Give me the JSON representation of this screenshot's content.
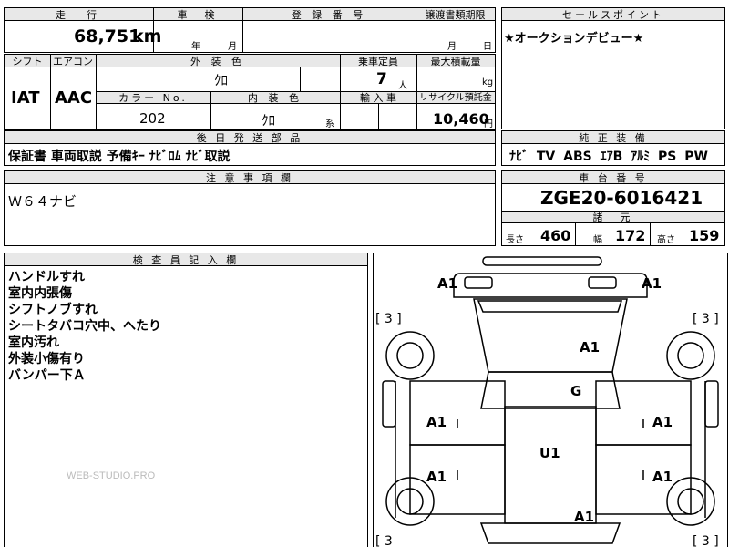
{
  "top_row": {
    "mileage_label": "走　行",
    "mileage_value": "68,751",
    "mileage_unit": "km",
    "inspection_label": "車　検",
    "inspection_year_unit": "年",
    "inspection_month_unit": "月",
    "registration_label": "登 録 番 号",
    "transfer_label": "譲渡書類期限",
    "transfer_month_unit": "月",
    "transfer_day_unit": "日"
  },
  "second_row": {
    "shift_label": "シフト",
    "shift_value": "IAT",
    "aircon_label": "エアコン",
    "aircon_value": "AAC",
    "exterior_color_label": "外 装 色",
    "exterior_color_value": "ｸﾛ",
    "capacity_label": "乗車定員",
    "capacity_value": "7",
    "capacity_unit": "人",
    "max_load_label": "最大積載量",
    "max_load_unit": "kg",
    "color_no_label": "カラー No.",
    "color_no_value": "202",
    "interior_color_label": "内 装 色",
    "interior_color_value": "ｸﾛ",
    "interior_color_unit": "系",
    "import_label": "輸 入 車",
    "recycle_label": "リサイクル預託金",
    "recycle_value": "10,460",
    "recycle_unit": "円"
  },
  "delivery_items": {
    "label": "後 日 発 送 部 品",
    "value": "保証書 車両取説 予備ｷｰ ﾅﾋﾞﾛﾑ ﾅﾋﾞ取説"
  },
  "sales_point": {
    "label": "セールスポイント",
    "value": "★オークションデビュー★"
  },
  "standard_equipment": {
    "label": "純 正 装 備",
    "value": "ﾅﾋﾞ TV ABS ｴｱB ｱﾙﾐ PS PW"
  },
  "notes": {
    "label": "注 意 事 項 欄",
    "value": "Ｗ６４ナビ"
  },
  "chassis": {
    "label": "車 台 番 号",
    "value": "ZGE20-6016421"
  },
  "dimensions": {
    "label": "諸　元",
    "length_label": "長さ",
    "length_value": "460",
    "width_label": "幅",
    "width_value": "172",
    "height_label": "高さ",
    "height_value": "159"
  },
  "inspector": {
    "label": "検 査 員 記 入 欄",
    "lines": [
      "ハンドルすれ",
      "室内内張傷",
      "シフトノブすれ",
      "シートタバコ穴中、へたり",
      "室内汚れ",
      "外装小傷有り",
      "バンパー下Ａ"
    ]
  },
  "diagram": {
    "marks": [
      "A1",
      "A1",
      "A1",
      "G",
      "A1",
      "A1",
      "U1",
      "A1",
      "A1",
      "A1"
    ],
    "tire_left_top": "[ 3 ]",
    "tire_right_top": "[ 3 ]",
    "tire_left_bottom": "[ 3",
    "tire_right_bottom": "[ 3 ]"
  },
  "watermark": "WEB-STUDIO.PRO"
}
